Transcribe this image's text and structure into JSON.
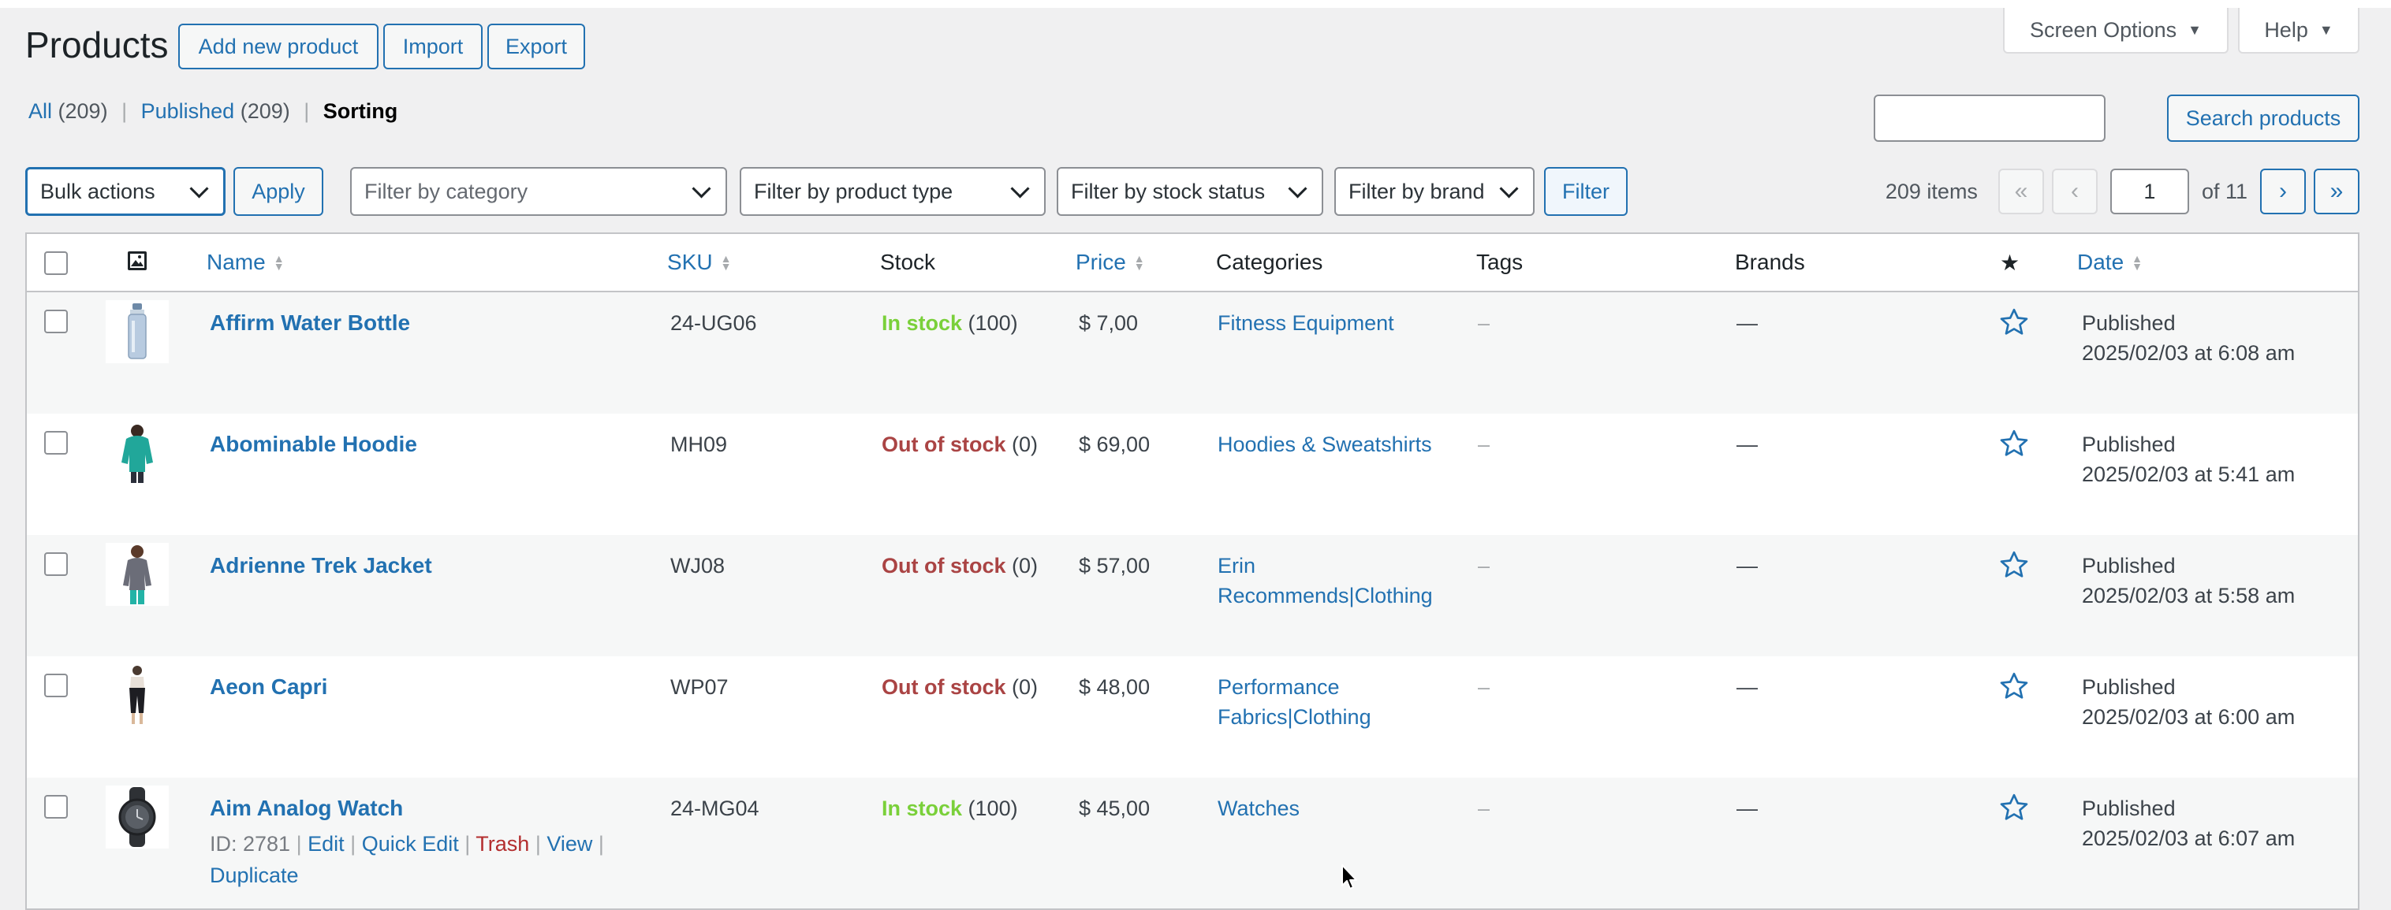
{
  "page": {
    "title": "Products",
    "add_new": "Add new product",
    "import": "Import",
    "export": "Export",
    "screen_options": "Screen Options",
    "help": "Help"
  },
  "views": {
    "all_label": "All",
    "all_count": "(209)",
    "published_label": "Published",
    "published_count": "(209)",
    "sorting_label": "Sorting",
    "separator": "|"
  },
  "search": {
    "placeholder": "",
    "button": "Search products"
  },
  "filters": {
    "bulk_actions": "Bulk actions",
    "apply": "Apply",
    "category": "Filter by category",
    "product_type": "Filter by product type",
    "stock_status": "Filter by stock status",
    "brand": "Filter by brand",
    "filter_button": "Filter"
  },
  "pagination": {
    "items": "209 items",
    "first": "«",
    "prev": "‹",
    "current": "1",
    "of": "of 11",
    "next": "›",
    "last": "»"
  },
  "columns": {
    "image_icon": "image-icon",
    "name": "Name",
    "sku": "SKU",
    "stock": "Stock",
    "price": "Price",
    "categories": "Categories",
    "tags": "Tags",
    "brands": "Brands",
    "featured": "★",
    "date": "Date"
  },
  "rows": [
    {
      "name": "Affirm Water Bottle",
      "sku": "24-UG06",
      "stock_status": "In stock",
      "stock_count": "(100)",
      "in_stock": true,
      "price": "$ 7,00",
      "categories": "Fitness Equipment",
      "tags": "–",
      "brands": "—",
      "date_status": "Published",
      "date": "2025/02/03 at 6:08 am"
    },
    {
      "name": "Abominable Hoodie",
      "sku": "MH09",
      "stock_status": "Out of stock",
      "stock_count": "(0)",
      "in_stock": false,
      "price": "$ 69,00",
      "categories": "Hoodies & Sweatshirts",
      "tags": "–",
      "brands": "—",
      "date_status": "Published",
      "date": "2025/02/03 at 5:41 am"
    },
    {
      "name": "Adrienne Trek Jacket",
      "sku": "WJ08",
      "stock_status": "Out of stock",
      "stock_count": "(0)",
      "in_stock": false,
      "price": "$ 57,00",
      "categories": "Erin Recommends|Clothing",
      "tags": "–",
      "brands": "—",
      "date_status": "Published",
      "date": "2025/02/03 at 5:58 am"
    },
    {
      "name": "Aeon Capri",
      "sku": "WP07",
      "stock_status": "Out of stock",
      "stock_count": "(0)",
      "in_stock": false,
      "price": "$ 48,00",
      "categories": "Performance Fabrics|Clothing",
      "tags": "–",
      "brands": "—",
      "date_status": "Published",
      "date": "2025/02/03 at 6:00 am"
    },
    {
      "name": "Aim Analog Watch",
      "sku": "24-MG04",
      "stock_status": "In stock",
      "stock_count": "(100)",
      "in_stock": true,
      "price": "$ 45,00",
      "categories": "Watches",
      "tags": "–",
      "brands": "—",
      "date_status": "Published",
      "date": "2025/02/03 at 6:07 am"
    }
  ],
  "row_actions": {
    "id": "ID: 2781",
    "edit": "Edit",
    "quick_edit": "Quick Edit",
    "trash": "Trash",
    "view": "View",
    "duplicate": "Duplicate",
    "sep": "|"
  },
  "colors": {
    "link": "#2271b1",
    "in_stock": "#7ad03a",
    "out_of_stock": "#aa4444",
    "trash": "#b32d2e",
    "background": "#f0f0f1"
  }
}
